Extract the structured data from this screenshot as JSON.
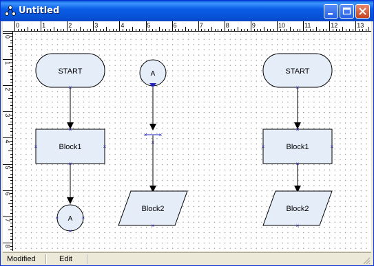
{
  "window": {
    "title": "Untitled"
  },
  "ruler": {
    "h_labels": [
      "0",
      "1",
      "2",
      "3",
      "4",
      "5",
      "6",
      "7",
      "8",
      "9",
      "10",
      "11",
      "12",
      "13"
    ],
    "v_labels": [
      "0",
      "1",
      "2",
      "3",
      "4",
      "5",
      "6",
      "7",
      "8"
    ]
  },
  "blocks": {
    "start1": "START",
    "block1a": "Block1",
    "connA1": "A",
    "connA2": "A",
    "block2a": "Block2",
    "start2": "START",
    "block1b": "Block1",
    "block2b": "Block2"
  },
  "status": {
    "mode": "Modified",
    "menu": "Edit"
  },
  "colors": {
    "shape_fill": "#e4edf8",
    "connector": "#000000",
    "port": "#1f1fbf",
    "title_blue": "#0a58d8"
  }
}
